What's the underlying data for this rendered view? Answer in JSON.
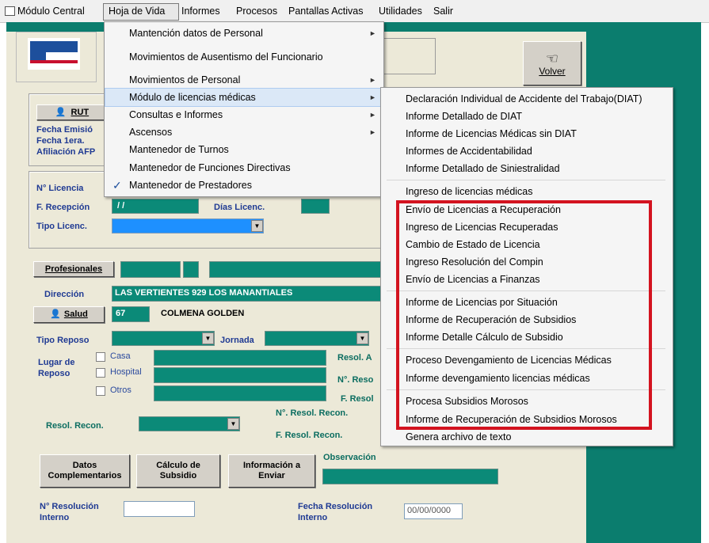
{
  "menubar": {
    "items": [
      "Módulo Central",
      "Hoja de Vida",
      "Informes",
      "Procesos",
      "Pantallas Activas",
      "Utilidades",
      "Salir"
    ]
  },
  "hoja_menu": {
    "items": [
      {
        "label": "Mantención datos de Personal",
        "submenu": true
      },
      {
        "label": "Movimientos de Ausentismo del Funcionario",
        "submenu": false
      },
      {
        "label": "Movimientos de Personal",
        "submenu": true
      },
      {
        "label": "Módulo de licencias médicas",
        "submenu": true
      },
      {
        "label": "Consultas e Informes",
        "submenu": true
      },
      {
        "label": "Ascensos",
        "submenu": true
      },
      {
        "label": "Mantenedor de Turnos",
        "submenu": false
      },
      {
        "label": "Mantenedor de Funciones Directivas",
        "submenu": false
      },
      {
        "label": "Mantenedor de Prestadores",
        "submenu": false,
        "checked": true
      }
    ]
  },
  "licencias_submenu": {
    "items": [
      "Declaración Individual de Accidente del Trabajo(DIAT)",
      "Informe Detallado de DIAT",
      "Informe de Licencias Médicas sin DIAT",
      "Informes de Accidentabilidad",
      "Informe Detallado de Siniestralidad",
      "Ingreso de licencias médicas",
      "Envío de Licencias a Recuperación",
      "Ingreso de Licencias Recuperadas",
      "Cambio de Estado de Licencia",
      "Ingreso Resolución del Compin",
      "Envío de Licencias a Finanzas",
      "Informe de Licencias por Situación",
      "Informe de Recuperación de Subsidios",
      "Informe Detalle Cálculo de Subsidio",
      "Proceso Devengamiento de Licencias Médicas",
      "Informe devengamiento licencias médicas",
      "Procesa Subsidios Morosos",
      "Informe de Recuperación de Subsidios Morosos",
      "Genera archivo de texto"
    ]
  },
  "toolbar": {
    "volver_label": "Volver"
  },
  "form": {
    "rut_button": "RUT",
    "fecha_emision": "Fecha Emisió",
    "fecha_1era": "Fecha 1era.",
    "afiliacion": "Afiliación AFP",
    "n_licencia": "N° Licencia",
    "f_recepcion": "F. Recepción",
    "f_recepcion_value": "/ /",
    "dias_licenc": "Días Licenc.",
    "tipo_licenc": "Tipo Licenc.",
    "profesionales_button": "Profesionales",
    "direccion": "Dirección",
    "direccion_value": "LAS VERTIENTES 929 LOS MANANTIALES",
    "salud_button": "Salud",
    "salud_code": "67",
    "salud_name": "COLMENA GOLDEN",
    "tipo_reposo": "Tipo Reposo",
    "jornada": "Jornada",
    "lugar_reposo": "Lugar de\nReposo",
    "lugar_line1": "Lugar de",
    "lugar_line2": "Reposo",
    "casa": "Casa",
    "hospital": "Hospital",
    "otros": "Otros",
    "resol_a": "Resol. A",
    "n_reso": "N°. Reso",
    "f_resol": "F. Resol",
    "n_resol_recon": "N°. Resol. Recon.",
    "resol_recon": "Resol. Recon.",
    "f_resol_recon": "F. Resol. Recon.",
    "datos_comp_1": "Datos",
    "datos_comp_2": "Complementarios",
    "calculo_1": "Cálculo de",
    "calculo_2": "Subsidio",
    "info_1": "Información a",
    "info_2": "Enviar",
    "observacion": "Observación",
    "n_resol_interno_1": "N° Resolución",
    "n_resol_interno_2": "Interno",
    "fecha_resol_interno_1": "Fecha Resolución",
    "fecha_resol_interno_2": "Interno",
    "fecha_resol_interno_value": "00/00/0000"
  },
  "colors": {
    "teal": "#0b8a78",
    "highlight_box": "#d3131f",
    "label_blue": "#1f3a93"
  }
}
